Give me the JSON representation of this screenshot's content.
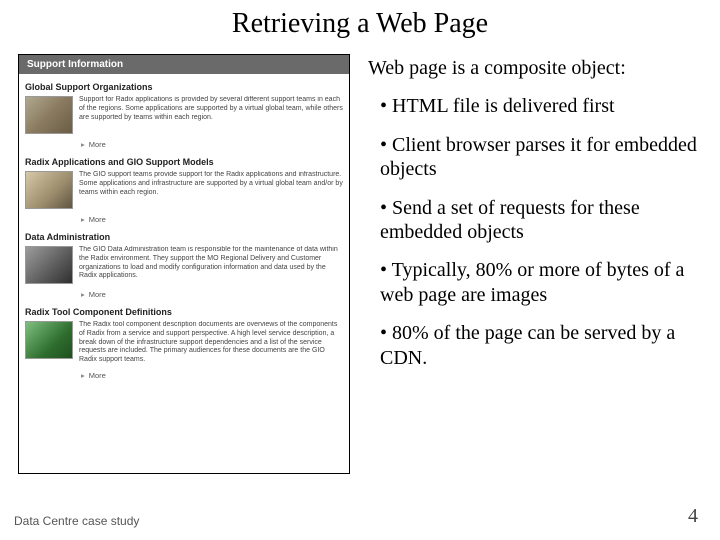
{
  "title": "Retrieving a Web Page",
  "intro": "Web page is a composite object:",
  "bullets": [
    "• HTML file is delivered first",
    "• Client browser parses it for embedded objects",
    "• Send a set of requests for these embedded objects",
    "• Typically, 80% or more of bytes of a web page are images",
    "• 80% of the page can be served by a CDN."
  ],
  "footer_left": "Data Centre case study",
  "slide_number": "4",
  "screenshot": {
    "header": "Support Information",
    "sections": [
      {
        "heading": "Global Support Organizations",
        "text": "Support for Radix applications is provided by several different support teams in each of the regions. Some applications are supported by a virtual global team, while others are supported by teams within each region.",
        "more": "More",
        "thumb": "t1"
      },
      {
        "heading": "Radix Applications and GIO Support Models",
        "text": "The GIO support teams provide support for the Radix applications and infrastructure. Some applications and infrastructure are supported by a virtual global team and/or by teams within each region.",
        "more": "More",
        "thumb": "t2"
      },
      {
        "heading": "Data Administration",
        "text": "The GIO Data Administration team is responsible for the maintenance of data within the Radix environment. They support the MO Regional Delivery and Customer organizations to load and modify configuration information and data used by the Radix applications.",
        "more": "More",
        "thumb": "t3"
      },
      {
        "heading": "Radix Tool Component Definitions",
        "text": "The Radix tool component description documents are overviews of the components of Radix from a service and support perspective. A high level service description, a break down of the infrastructure support dependencies and a list of the service requests are included. The primary audiences for these documents are the GIO Radix support teams.",
        "more": "More",
        "thumb": "t4"
      }
    ]
  }
}
